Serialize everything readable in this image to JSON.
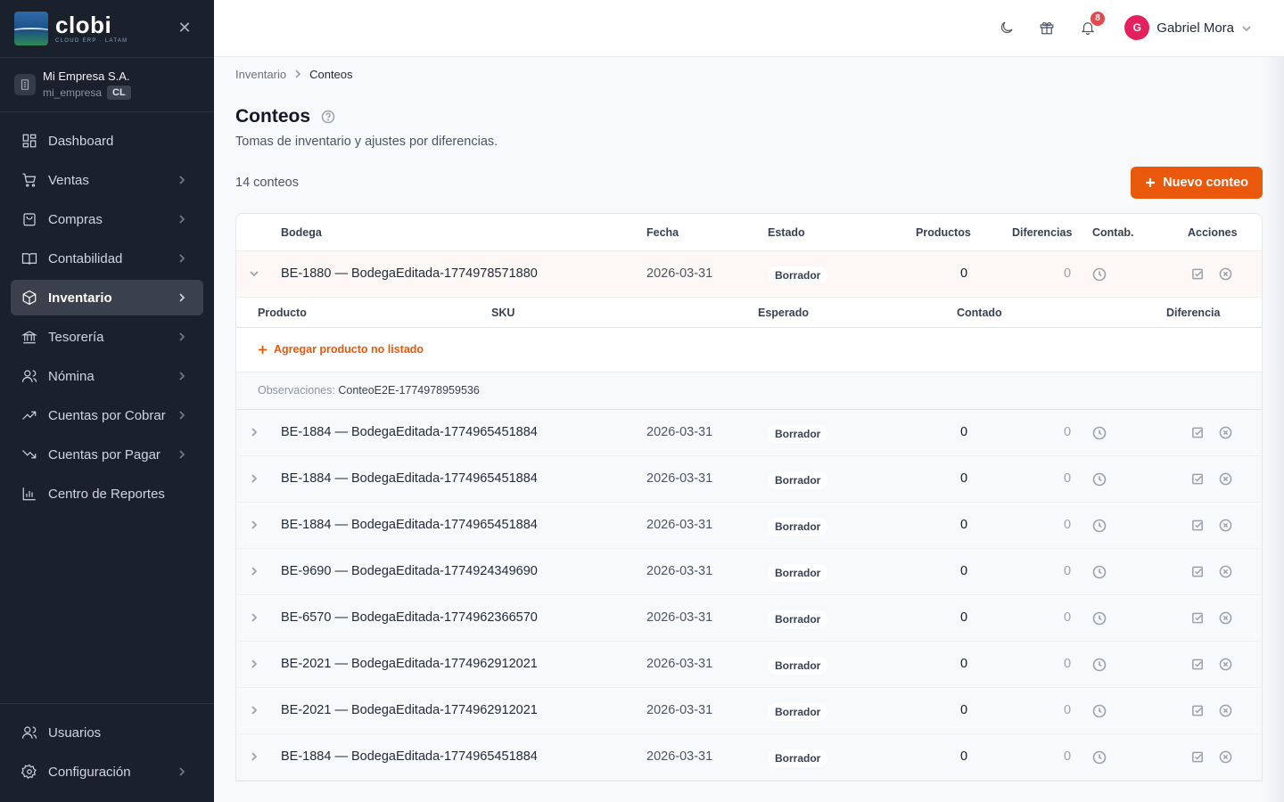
{
  "brand": {
    "name": "clobi",
    "tagline": "CLOUD ERP · LATAM"
  },
  "company": {
    "name": "Mi Empresa S.A.",
    "slug": "mi_empresa",
    "country": "CL"
  },
  "nav": {
    "items": [
      {
        "label": "Dashboard",
        "icon": "dashboard-icon",
        "chevron": false
      },
      {
        "label": "Ventas",
        "icon": "cart-icon",
        "chevron": true
      },
      {
        "label": "Compras",
        "icon": "shopping-bag-icon",
        "chevron": true
      },
      {
        "label": "Contabilidad",
        "icon": "book-icon",
        "chevron": true
      },
      {
        "label": "Inventario",
        "icon": "box-icon",
        "chevron": true,
        "active": true
      },
      {
        "label": "Tesorería",
        "icon": "bank-icon",
        "chevron": true
      },
      {
        "label": "Nómina",
        "icon": "users-icon",
        "chevron": true
      },
      {
        "label": "Cuentas por Cobrar",
        "icon": "trend-up-icon",
        "chevron": true
      },
      {
        "label": "Cuentas por Pagar",
        "icon": "trend-down-icon",
        "chevron": true
      },
      {
        "label": "Centro de Reportes",
        "icon": "bar-chart-icon",
        "chevron": false
      }
    ],
    "bottom": [
      {
        "label": "Usuarios",
        "icon": "user-group-icon",
        "chevron": false
      },
      {
        "label": "Configuración",
        "icon": "gear-icon",
        "chevron": true
      }
    ]
  },
  "topbar": {
    "notifications": "8",
    "user_initial": "G",
    "user_name": "Gabriel Mora"
  },
  "breadcrumb": {
    "parent": "Inventario",
    "current": "Conteos"
  },
  "page": {
    "title": "Conteos",
    "subtitle": "Tomas de inventario y ajustes por diferencias.",
    "count": "14 conteos",
    "new_button": "Nuevo conteo"
  },
  "table": {
    "headers": {
      "bodega": "Bodega",
      "fecha": "Fecha",
      "estado": "Estado",
      "productos": "Productos",
      "diferencias": "Diferencias",
      "contab": "Contab.",
      "acciones": "Acciones"
    },
    "detail_headers": {
      "producto": "Producto",
      "sku": "SKU",
      "esperado": "Esperado",
      "contado": "Contado",
      "diferencia": "Diferencia"
    },
    "add_label": "Agregar producto no listado",
    "obs_label": "Observaciones:",
    "obs_value": "ConteoE2E-1774978959536",
    "rows": [
      {
        "bodega": "BE-1880 — BodegaEditada-1774978571880",
        "fecha": "2026-03-31",
        "estado": "Borrador",
        "productos": "0",
        "diferencias": "0",
        "expanded": true
      },
      {
        "bodega": "BE-1884 — BodegaEditada-1774965451884",
        "fecha": "2026-03-31",
        "estado": "Borrador",
        "productos": "0",
        "diferencias": "0"
      },
      {
        "bodega": "BE-1884 — BodegaEditada-1774965451884",
        "fecha": "2026-03-31",
        "estado": "Borrador",
        "productos": "0",
        "diferencias": "0"
      },
      {
        "bodega": "BE-1884 — BodegaEditada-1774965451884",
        "fecha": "2026-03-31",
        "estado": "Borrador",
        "productos": "0",
        "diferencias": "0"
      },
      {
        "bodega": "BE-9690 — BodegaEditada-1774924349690",
        "fecha": "2026-03-31",
        "estado": "Borrador",
        "productos": "0",
        "diferencias": "0"
      },
      {
        "bodega": "BE-6570 — BodegaEditada-1774962366570",
        "fecha": "2026-03-31",
        "estado": "Borrador",
        "productos": "0",
        "diferencias": "0"
      },
      {
        "bodega": "BE-2021 — BodegaEditada-1774962912021",
        "fecha": "2026-03-31",
        "estado": "Borrador",
        "productos": "0",
        "diferencias": "0"
      },
      {
        "bodega": "BE-2021 — BodegaEditada-1774962912021",
        "fecha": "2026-03-31",
        "estado": "Borrador",
        "productos": "0",
        "diferencias": "0"
      },
      {
        "bodega": "BE-1884 — BodegaEditada-1774965451884",
        "fecha": "2026-03-31",
        "estado": "Borrador",
        "productos": "0",
        "diferencias": "0"
      }
    ]
  }
}
